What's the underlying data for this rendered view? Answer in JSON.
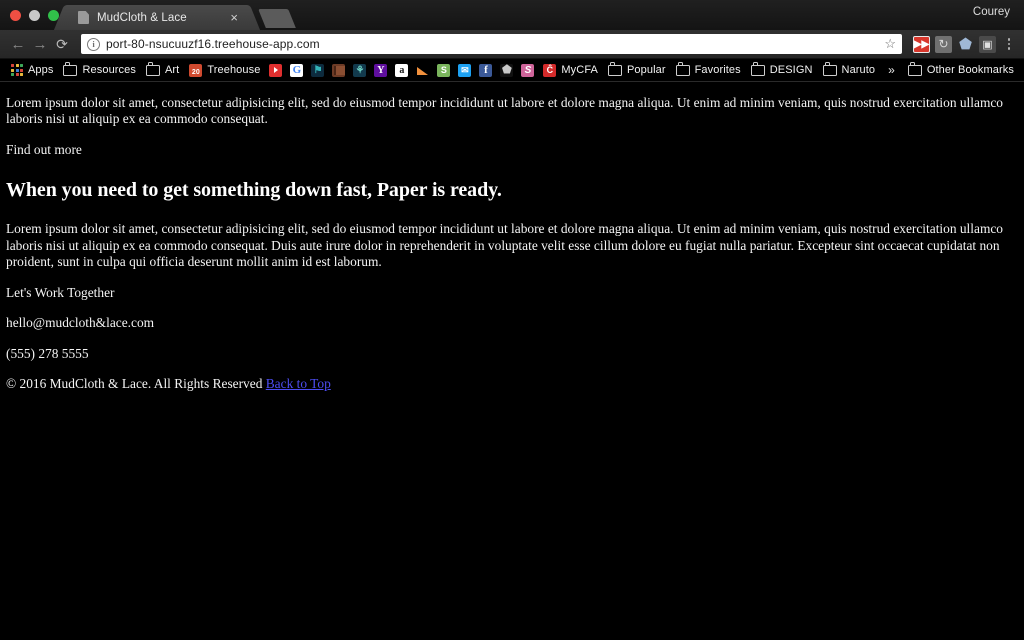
{
  "window": {
    "profile_name": "Courey",
    "traffic_lights": [
      "close-red",
      "minimize-gray",
      "zoom-green"
    ]
  },
  "tab": {
    "title": "MudCloth & Lace",
    "favicon": "page-icon",
    "close_label": "×",
    "new_tab_label": ""
  },
  "toolbar": {
    "back_label": "←",
    "forward_label": "→",
    "reload_label": "⟳",
    "info_label": "i",
    "url": "port-80-nsucuuzf16.treehouse-app.com",
    "star_label": "☆",
    "extensions": [
      {
        "name": "adblock-extension",
        "glyph": "▶▶",
        "class": "ext-ab"
      },
      {
        "name": "sync-extension",
        "glyph": "↻",
        "class": "ext-sync"
      },
      {
        "name": "security-shield-extension",
        "glyph": "⬟",
        "class": "ext-shield"
      },
      {
        "name": "pocket-extension",
        "glyph": "▣",
        "class": "ext-dark"
      }
    ],
    "menu_label": "⋮"
  },
  "bookmarks": {
    "items": [
      {
        "name": "bookmark-apps",
        "label": "Apps",
        "icon": "apps-grid-icon",
        "icon_class": "ico-apps"
      },
      {
        "name": "bookmark-resources",
        "label": "Resources",
        "icon": "folder-icon",
        "icon_class": "folder"
      },
      {
        "name": "bookmark-art",
        "label": "Art",
        "icon": "folder-icon",
        "icon_class": "folder"
      },
      {
        "name": "bookmark-treehouse",
        "label": "Treehouse",
        "icon": "treehouse-icon",
        "icon_class": "ico-treehouse"
      },
      {
        "name": "bookmark-youtube",
        "label": "",
        "icon": "youtube-icon",
        "icon_class": "ico-yt"
      },
      {
        "name": "bookmark-google",
        "label": "",
        "icon": "google-icon",
        "icon_class": "ico-google",
        "glyph": "G"
      },
      {
        "name": "bookmark-teal-site",
        "label": "",
        "icon": "bookmark-teal-icon",
        "icon_class": "ico-teal",
        "glyph": "⚑"
      },
      {
        "name": "bookmark-book",
        "label": "",
        "icon": "book-icon",
        "icon_class": "ico-book"
      },
      {
        "name": "bookmark-plant",
        "label": "",
        "icon": "plant-icon",
        "icon_class": "ico-plant",
        "glyph": "⚘"
      },
      {
        "name": "bookmark-yahoo",
        "label": "",
        "icon": "yahoo-icon",
        "icon_class": "ico-yahoo",
        "glyph": "Y"
      },
      {
        "name": "bookmark-amazon",
        "label": "",
        "icon": "amazon-icon",
        "icon_class": "ico-amazon",
        "glyph": "a"
      },
      {
        "name": "bookmark-analytics",
        "label": "",
        "icon": "chart-icon",
        "icon_class": "ico-chart"
      },
      {
        "name": "bookmark-shopify",
        "label": "",
        "icon": "shopify-icon",
        "icon_class": "ico-shopify",
        "glyph": "S"
      },
      {
        "name": "bookmark-twitter",
        "label": "",
        "icon": "twitter-icon",
        "icon_class": "ico-twitter",
        "glyph": "✉"
      },
      {
        "name": "bookmark-facebook",
        "label": "",
        "icon": "facebook-icon",
        "icon_class": "ico-facebook",
        "glyph": "f"
      },
      {
        "name": "bookmark-shield",
        "label": "",
        "icon": "shield-icon",
        "icon_class": "ico-shield2",
        "glyph": "⬟"
      },
      {
        "name": "bookmark-sass",
        "label": "",
        "icon": "sass-icon",
        "icon_class": "ico-sass",
        "glyph": "S"
      },
      {
        "name": "bookmark-mycfa",
        "label": "MyCFA",
        "icon": "mycfa-icon",
        "icon_class": "ico-mycfa",
        "glyph": "Ĉ"
      },
      {
        "name": "bookmark-popular",
        "label": "Popular",
        "icon": "folder-icon",
        "icon_class": "folder"
      },
      {
        "name": "bookmark-favorites",
        "label": "Favorites",
        "icon": "folder-icon",
        "icon_class": "folder"
      },
      {
        "name": "bookmark-design",
        "label": "DESIGN",
        "icon": "folder-icon",
        "icon_class": "folder"
      },
      {
        "name": "bookmark-naruto",
        "label": "Naruto",
        "icon": "folder-icon",
        "icon_class": "folder"
      }
    ],
    "overflow_label": "»",
    "other_bookmarks_label": "Other Bookmarks"
  },
  "content": {
    "paragraph_1": "Lorem ipsum dolor sit amet, consectetur adipisicing elit, sed do eiusmod tempor incididunt ut labore et dolore magna aliqua. Ut enim ad minim veniam, quis nostrud exercitation ullamco laboris nisi ut aliquip ex ea commodo consequat.",
    "find_out_more": "Find out more",
    "heading": "When you need to get something down fast, Paper is ready.",
    "paragraph_2": "Lorem ipsum dolor sit amet, consectetur adipisicing elit, sed do eiusmod tempor incididunt ut labore et dolore magna aliqua. Ut enim ad minim veniam, quis nostrud exercitation ullamco laboris nisi ut aliquip ex ea commodo consequat. Duis aute irure dolor in reprehenderit in voluptate velit esse cillum dolore eu fugiat nulla pariatur. Excepteur sint occaecat cupidatat non proident, sunt in culpa qui officia deserunt mollit anim id est laborum.",
    "lets_work_together": "Let's Work Together",
    "email": "hello@mudcloth&lace.com",
    "phone": "(555) 278 5555",
    "copyright": "© 2016 MudCloth & Lace. All Rights Reserved ",
    "back_to_top": "Back to Top"
  },
  "colors": {
    "page_background": "#000000",
    "page_text": "#f4f4f4",
    "link": "#4d4df2",
    "chrome_toolbar": "#2b2b2b",
    "bookmarks_bar": "#000000"
  }
}
